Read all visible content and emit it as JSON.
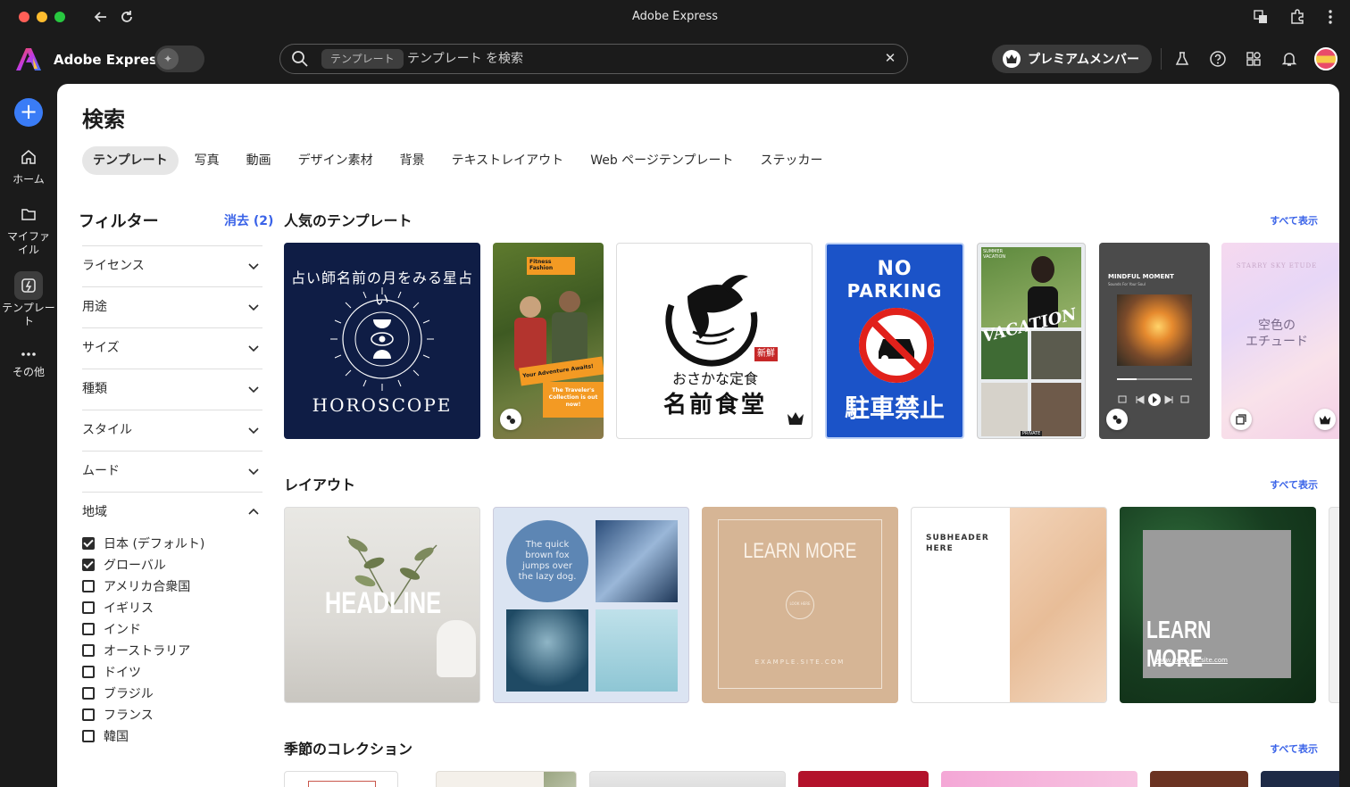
{
  "window": {
    "title": "Adobe Express"
  },
  "header": {
    "brand": "Adobe Express",
    "search": {
      "chip": "テンプレート",
      "placeholder": "テンプレート を検索"
    },
    "premium_label": "プレミアムメンバー"
  },
  "rail": {
    "items": [
      {
        "label": "ホーム",
        "icon": "home-icon"
      },
      {
        "label": "マイファイル",
        "icon": "folder-icon"
      },
      {
        "label": "テンプレート",
        "icon": "templates-icon"
      },
      {
        "label": "その他",
        "icon": "more-icon"
      }
    ]
  },
  "page": {
    "title": "検索",
    "tabs": [
      "テンプレート",
      "写真",
      "動画",
      "デザイン素材",
      "背景",
      "テキストレイアウト",
      "Web ページテンプレート",
      "ステッカー"
    ]
  },
  "filters": {
    "title": "フィルター",
    "clear": "消去 (2)",
    "groups": [
      "ライセンス",
      "用途",
      "サイズ",
      "種類",
      "スタイル",
      "ムード",
      "地域"
    ],
    "regions": [
      {
        "label": "日本 (デフォルト)",
        "checked": true
      },
      {
        "label": "グローバル",
        "checked": true
      },
      {
        "label": "アメリカ合衆国",
        "checked": false
      },
      {
        "label": "イギリス",
        "checked": false
      },
      {
        "label": "インド",
        "checked": false
      },
      {
        "label": "オーストラリア",
        "checked": false
      },
      {
        "label": "ドイツ",
        "checked": false
      },
      {
        "label": "ブラジル",
        "checked": false
      },
      {
        "label": "フランス",
        "checked": false
      },
      {
        "label": "韓国",
        "checked": false
      }
    ]
  },
  "sections": {
    "popular": {
      "title": "人気のテンプレート",
      "see_all": "すべて表示"
    },
    "layout": {
      "title": "レイアウト",
      "see_all": "すべて表示"
    },
    "seasonal": {
      "title": "季節のコレクション",
      "see_all": "すべて表示"
    }
  },
  "popular_cards": {
    "horoscope": {
      "arc": "占い師名前の月をみる星占い",
      "bottom": "HOROSCOPE"
    },
    "fitness": {
      "brand": "Fitness Fashion",
      "tag1": "Your Adventure Awaits!",
      "tag2": "The Traveler's Collection is out now!"
    },
    "teishoku": {
      "badge": "新鮮",
      "line1": "おさかな定食",
      "line2": "名前食堂"
    },
    "parking": {
      "line1": "NO",
      "line2": "PARKING",
      "bottom": "駐車禁止"
    },
    "vacation": {
      "small": "SUMMER VACATION",
      "script": "VACATION",
      "tag": "PRIVATE"
    },
    "mindful": {
      "title": "MINDFUL MOMENT",
      "sub": "Sounds For Your Soul"
    },
    "etude": {
      "arc": "STARRY SKY ETUDE",
      "line1": "空色の",
      "line2": "エチュード"
    }
  },
  "layout_cards": {
    "headline": "HEADLINE",
    "quick": "The quick brown fox jumps over the lazy dog.",
    "learn1": {
      "title": "LEARN MORE",
      "circle": "LOOK HERE",
      "url": "EXAMPLE.SITE.COM"
    },
    "subheader": "SUBHEADER HERE",
    "learn2": {
      "title": "LEARN MORE",
      "url": "www.example.site.com"
    }
  },
  "colors": {
    "accent": "#3a63e8",
    "add_button": "#3a7cf6",
    "sidebar_bg": "#1b1b1b"
  }
}
